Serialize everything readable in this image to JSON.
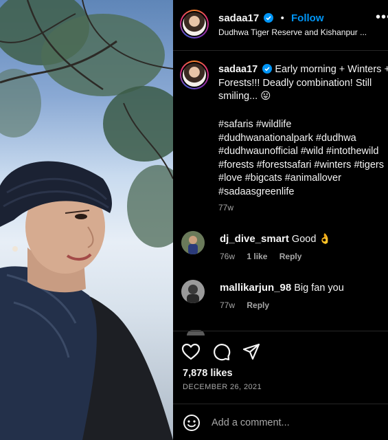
{
  "post": {
    "username": "sadaa17",
    "follow_label": "Follow",
    "separator": "•",
    "location": "Dudhwa Tiger Reserve and Kishanpur ...",
    "more_label": "•••"
  },
  "caption": {
    "username": "sadaa17",
    "text": "Early morning + Winters + Forests!!! Deadly combination! Still smiling... 😛",
    "hashtag_lines": [
      "#safaris #wildlife",
      "#dudhwanationalpark #dudhwa",
      "#dudhwaunofficial #wild #intothewild",
      "#forests #forestsafari #winters #tigers",
      "#love #bigcats #animallover",
      "#sadaasgreenlife"
    ],
    "time": "77w"
  },
  "comments": [
    {
      "username": "dj_dive_smart",
      "text": "Good 👌",
      "time": "76w",
      "likes": "1 like",
      "reply_label": "Reply"
    },
    {
      "username": "mallikarjun_98",
      "text": "Big fan you",
      "time": "77w",
      "reply_label": "Reply"
    }
  ],
  "engagement": {
    "likes": "7,878 likes",
    "date": "DECEMBER 26, 2021"
  },
  "comment_box": {
    "placeholder": "Add a comment..."
  },
  "icons": {
    "like": "heart-icon",
    "comment": "comment-bubble-icon",
    "share": "paper-plane-icon",
    "emoji": "smiley-icon",
    "verified": "verified-badge-icon"
  },
  "colors": {
    "accent": "#0095f6",
    "background": "#000000",
    "secondary_text": "#a8a8a8",
    "divider": "#262626"
  }
}
